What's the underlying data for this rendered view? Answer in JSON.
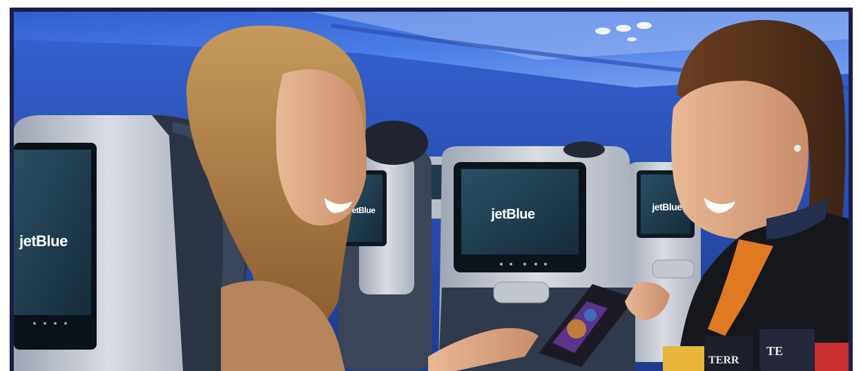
{
  "photo": {
    "brand_small_screen": "jetBlue",
    "brand_left_screen": "jetBlue",
    "brand_center_screen": "jetBlue",
    "brand_right_screen": "jetBlue",
    "snack_label_1": "TERR",
    "snack_label_2": "TE"
  },
  "colors": {
    "frame_border": "#1c1d4a",
    "cabin_light": "#3a6fd8",
    "seat_shell": "#c9ccd3",
    "seat_fabric": "#2e3a4e",
    "uniform_orange": "#e07a22"
  }
}
